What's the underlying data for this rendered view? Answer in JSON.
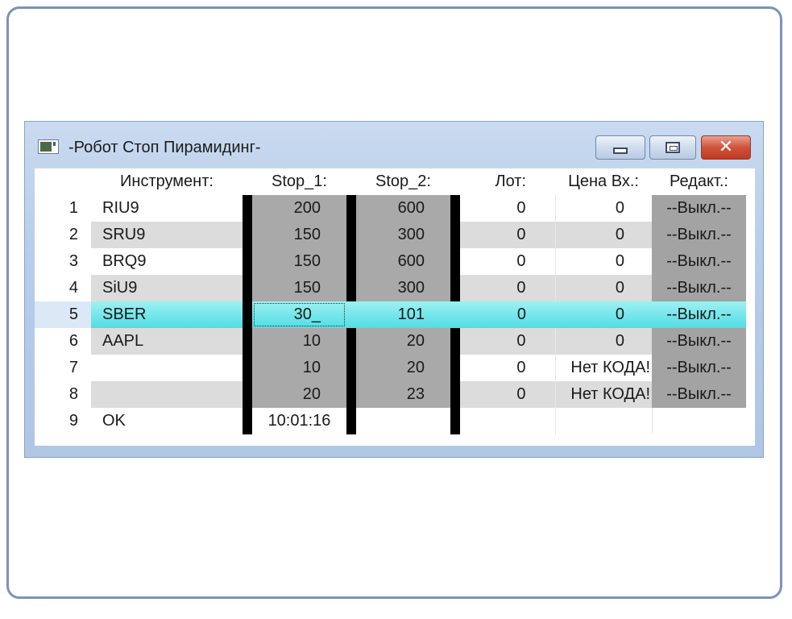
{
  "window": {
    "title": "-Робот Стоп Пирамидинг-",
    "icon": "app-window-icon",
    "controls": [
      "minimize-icon",
      "maximize-icon",
      "close-icon"
    ]
  },
  "table": {
    "headers": [
      "Инструмент:",
      "Stop_1:",
      "Stop_2:",
      "Лот:",
      "Цена Вх.:",
      "Редакт.:"
    ],
    "rows": [
      {
        "n": "1",
        "inst": "RIU9",
        "s1": "200",
        "s2": "600",
        "lot": "0",
        "price": "0",
        "edit": "--Выкл.--"
      },
      {
        "n": "2",
        "inst": "SRU9",
        "s1": "150",
        "s2": "300",
        "lot": "0",
        "price": "0",
        "edit": "--Выкл.--"
      },
      {
        "n": "3",
        "inst": "BRQ9",
        "s1": "150",
        "s2": "600",
        "lot": "0",
        "price": "0",
        "edit": "--Выкл.--"
      },
      {
        "n": "4",
        "inst": "SiU9",
        "s1": "150",
        "s2": "300",
        "lot": "0",
        "price": "0",
        "edit": "--Выкл.--"
      },
      {
        "n": "5",
        "inst": "SBER",
        "s1": "30_",
        "s2": "101",
        "lot": "0",
        "price": "0",
        "edit": "--Выкл.--"
      },
      {
        "n": "6",
        "inst": "AAPL",
        "s1": "10",
        "s2": "20",
        "lot": "0",
        "price": "0",
        "edit": "--Выкл.--"
      },
      {
        "n": "7",
        "inst": "",
        "s1": "10",
        "s2": "20",
        "lot": "0",
        "price": "Нет КОДА!",
        "edit": "--Выкл.--"
      },
      {
        "n": "8",
        "inst": "",
        "s1": "20",
        "s2": "23",
        "lot": "0",
        "price": "Нет КОДА!",
        "edit": "--Выкл.--"
      },
      {
        "n": "9",
        "inst": "OK",
        "s1": "10:01:16",
        "s2": "",
        "lot": "",
        "price": "",
        "edit": ""
      }
    ],
    "selected_row": 5
  },
  "colors": {
    "row_light": "#dcdcdc",
    "stop_cell": "#a9a9a9",
    "edit_cell": "#a3a3a3",
    "selection": "#4fdde4",
    "separator": "#000000"
  }
}
